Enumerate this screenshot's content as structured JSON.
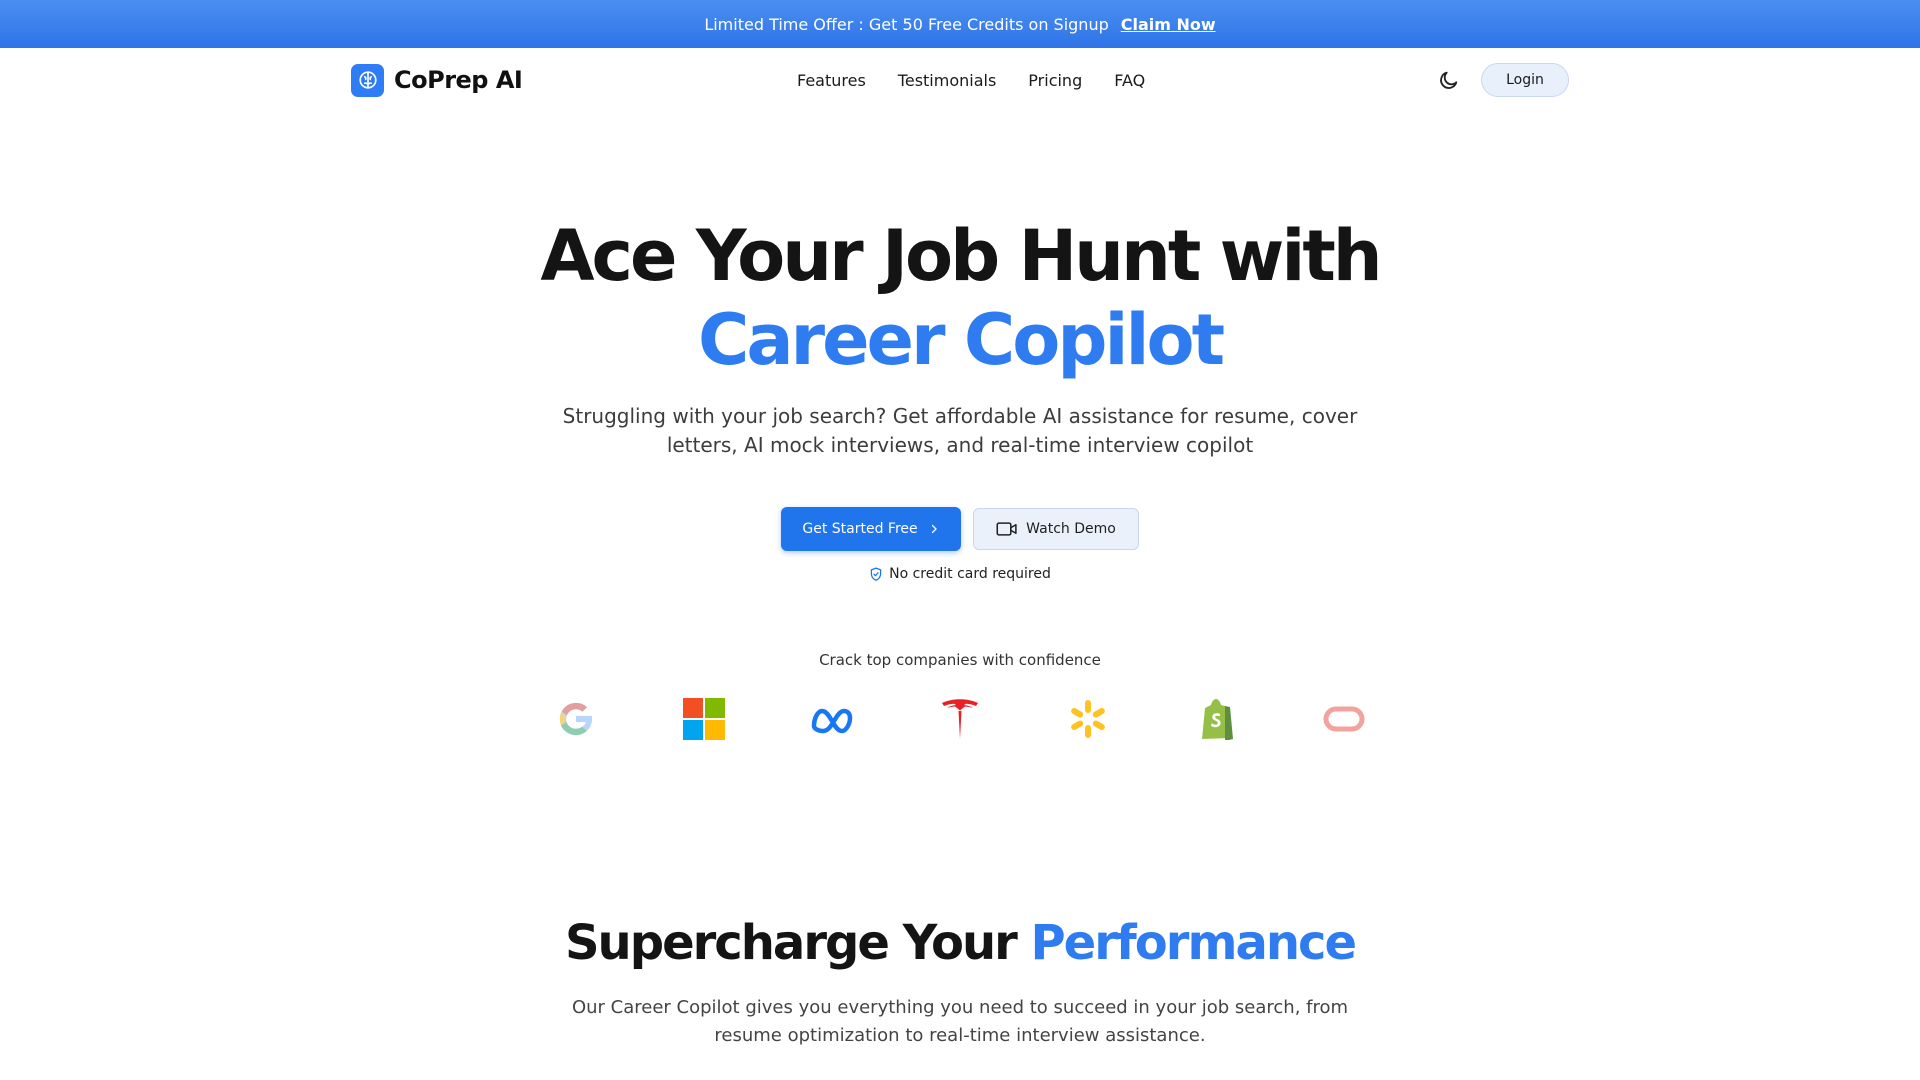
{
  "promo": {
    "text": "Limited Time Offer : Get 50 Free Credits on Signup",
    "link": "Claim Now"
  },
  "nav": {
    "brand": "CoPrep AI",
    "links": [
      "Features",
      "Testimonials",
      "Pricing",
      "FAQ"
    ],
    "login": "Login",
    "theme_icon": "moon-icon"
  },
  "hero": {
    "title_line1": "Ace Your Job Hunt with",
    "title_line2": "Career Copilot",
    "subtitle": "Struggling with your job search? Get affordable AI assistance for resume, cover letters, AI mock interviews, and real-time interview copilot",
    "primary_cta": "Get Started Free",
    "secondary_cta": "Watch Demo",
    "note": "No credit card required"
  },
  "companies": {
    "title": "Crack top companies with confidence",
    "logos": [
      "google-logo",
      "microsoft-logo",
      "meta-logo",
      "tesla-logo",
      "walmart-logo",
      "shopify-logo",
      "oracle-logo"
    ]
  },
  "section": {
    "title_part1": "Supercharge Your",
    "title_part2": "Performance",
    "subtitle": "Our Career Copilot gives you everything you need to succeed in your job search, from resume optimization to real-time interview assistance."
  },
  "colors": {
    "accent": "#2e7cf0",
    "promo_bar": "#3b82f0",
    "primary_button": "#2074ec"
  }
}
